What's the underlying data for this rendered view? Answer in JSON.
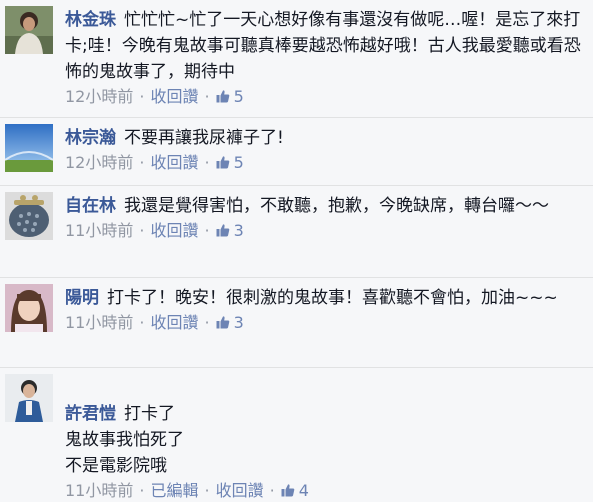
{
  "comments": [
    {
      "author": "林金珠",
      "text": "忙忙忙~忙了一天心想好像有事還沒有做呢…喔！是忘了來打卡;哇！今晚有鬼故事可聽真棒要越恐怖越好哦！古人我最愛聽或看恐怖的鬼故事了，期待中",
      "time": "12小時前",
      "edited": "",
      "action": "收回讚",
      "likes": "5",
      "avatar": "woman-photo"
    },
    {
      "author": "林宗瀚",
      "text": "不要再讓我尿褲子了!",
      "time": "12小時前",
      "edited": "",
      "action": "收回讚",
      "likes": "5",
      "avatar": "sky-landscape-photo"
    },
    {
      "author": "自在林",
      "text": "我還是覺得害怕，不敢聽，抱歉，今晚缺席，轉台囉～～",
      "time": "11小時前",
      "edited": "",
      "action": "收回讚",
      "likes": "3",
      "avatar": "coin-purse-photo"
    },
    {
      "author": "陽明",
      "text": "打卡了！晚安！很刺激的鬼故事！喜歡聽不會怕，加油~~~",
      "time": "11小時前",
      "edited": "",
      "action": "收回讚",
      "likes": "3",
      "avatar": "woman-portrait-photo"
    },
    {
      "author": "許君愷",
      "text": "打卡了\n鬼故事我怕死了\n不是電影院哦",
      "time": "11小時前",
      "edited": "已編輯",
      "action": "收回讚",
      "likes": "4",
      "avatar": "man-portrait-photo"
    }
  ],
  "separator": "·",
  "like_icon": "thumbs-up-icon",
  "colors": {
    "author": "#3b5998",
    "link": "#6d84b4",
    "muted": "#9197a3",
    "background": "#f6f7f9"
  }
}
